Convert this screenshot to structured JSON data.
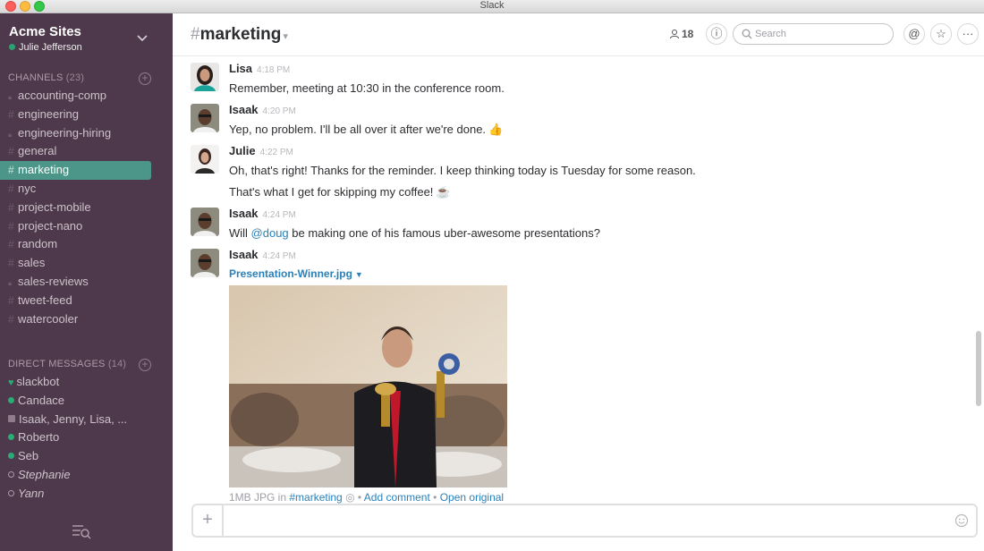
{
  "window": {
    "title": "Slack"
  },
  "team": {
    "name": "Acme Sites",
    "user": "Julie Jefferson"
  },
  "channels": {
    "header": "CHANNELS",
    "count": "(23)",
    "items": [
      {
        "name": "accounting-comp",
        "prefix": "lock"
      },
      {
        "name": "engineering",
        "prefix": "hash"
      },
      {
        "name": "engineering-hiring",
        "prefix": "lock"
      },
      {
        "name": "general",
        "prefix": "hash"
      },
      {
        "name": "marketing",
        "prefix": "hash",
        "active": true
      },
      {
        "name": "nyc",
        "prefix": "hash"
      },
      {
        "name": "project-mobile",
        "prefix": "hash"
      },
      {
        "name": "project-nano",
        "prefix": "hash"
      },
      {
        "name": "random",
        "prefix": "hash"
      },
      {
        "name": "sales",
        "prefix": "hash"
      },
      {
        "name": "sales-reviews",
        "prefix": "lock"
      },
      {
        "name": "tweet-feed",
        "prefix": "hash"
      },
      {
        "name": "watercooler",
        "prefix": "hash"
      }
    ]
  },
  "direct_messages": {
    "header": "DIRECT MESSAGES",
    "count": "(14)",
    "items": [
      {
        "name": "slackbot",
        "status": "heart"
      },
      {
        "name": "Candace",
        "status": "online"
      },
      {
        "name": "Isaak, Jenny, Lisa, ...",
        "status": "group"
      },
      {
        "name": "Roberto",
        "status": "online"
      },
      {
        "name": "Seb",
        "status": "online"
      },
      {
        "name": "Stephanie",
        "status": "away"
      },
      {
        "name": "Yann",
        "status": "away"
      }
    ]
  },
  "header": {
    "hash": "#",
    "channel": "marketing",
    "member_count": "18",
    "search_placeholder": "Search"
  },
  "messages": [
    {
      "author": "Lisa",
      "time": "4:18 PM",
      "text": "Remember, meeting at 10:30 in the conference room."
    },
    {
      "author": "Isaak",
      "time": "4:20 PM",
      "text": "Yep, no problem. I'll be all over it after we're done."
    },
    {
      "author": "Julie",
      "time": "4:22 PM",
      "text": "Oh, that's right! Thanks for the reminder. I keep thinking today is Tuesday for some reason.",
      "text2": "That's what I get for skipping my coffee!"
    },
    {
      "author": "Isaak",
      "time": "4:24 PM",
      "text_before": "Will ",
      "mention": "@doug",
      "text_after": " be making one of his famous uber-awesome presentations?"
    },
    {
      "author": "Isaak",
      "time": "4:24 PM",
      "file_name": "Presentation-Winner.jpg",
      "file_size": "1MB JPG in ",
      "file_channel": "#marketing",
      "add_comment": "Add comment",
      "open_original": "Open original"
    }
  ],
  "icons": {
    "thumbs_up": "👍",
    "coffee": "☕"
  },
  "colors": {
    "sidebar": "#4d394b",
    "active_channel": "#4c9689",
    "presence": "#2bac76",
    "link": "#2a80b9"
  }
}
